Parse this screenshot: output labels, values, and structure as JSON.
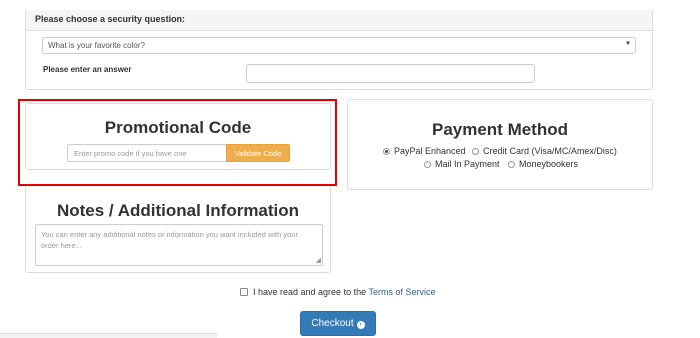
{
  "security": {
    "title": "Please choose a security question:",
    "selected_question": "What is your favorite color?",
    "answer_label": "Please enter an answer",
    "answer_value": ""
  },
  "promo": {
    "title": "Promotional Code",
    "input_placeholder": "Enter promo code if you have one",
    "button_label": "Validate Code"
  },
  "payment": {
    "title": "Payment Method",
    "options": [
      {
        "label": "PayPal Enhanced",
        "checked": true
      },
      {
        "label": "Credit Card (Visa/MC/Amex/Disc)",
        "checked": false
      },
      {
        "label": "Mail In Payment",
        "checked": false
      },
      {
        "label": "Moneybookers",
        "checked": false
      }
    ]
  },
  "notes": {
    "title": "Notes / Additional Information",
    "placeholder": "You can enter any additional notes or information you want included with your order here..."
  },
  "tos": {
    "text": "I have read and agree to the",
    "link": "Terms of Service"
  },
  "checkout": {
    "label": "Checkout"
  },
  "colors": {
    "highlight": "#e30000",
    "validate_button": "#f0ad4e",
    "checkout_button": "#337ab7",
    "link": "#2a6496"
  },
  "icons": {
    "checkout": "arrow-circle-right-icon",
    "select": "caret-down-icon"
  }
}
